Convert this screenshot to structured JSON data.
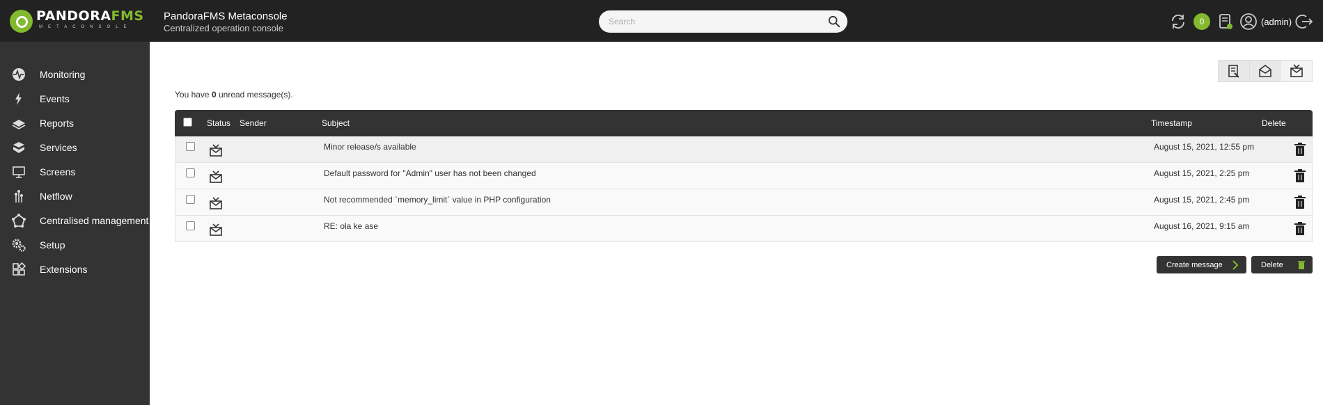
{
  "header": {
    "logo_main_a": "PANDORA",
    "logo_main_b": "FMS",
    "logo_sub": "METACONSOLE",
    "app_title": "PandoraFMS Metaconsole",
    "app_subtitle": "Centralized operation console",
    "search_placeholder": "Search",
    "notification_count": "0",
    "user_label": "(admin)"
  },
  "sidebar": {
    "items": [
      {
        "label": "Monitoring",
        "icon": "monitoring-icon"
      },
      {
        "label": "Events",
        "icon": "bolt-icon"
      },
      {
        "label": "Reports",
        "icon": "reports-icon"
      },
      {
        "label": "Services",
        "icon": "services-icon"
      },
      {
        "label": "Screens",
        "icon": "monitor-icon"
      },
      {
        "label": "Netflow",
        "icon": "netflow-icon"
      },
      {
        "label": "Centralised management",
        "icon": "network-icon"
      },
      {
        "label": "Setup",
        "icon": "gears-icon"
      },
      {
        "label": "Extensions",
        "icon": "extensions-icon"
      }
    ]
  },
  "main": {
    "unread_prefix": "You have ",
    "unread_count": "0",
    "unread_suffix": " unread message(s).",
    "columns": {
      "status": "Status",
      "sender": "Sender",
      "subject": "Subject",
      "timestamp": "Timestamp",
      "delete": "Delete"
    },
    "messages": [
      {
        "subject": "Minor release/s available",
        "timestamp": "August 15, 2021, 12:55 pm"
      },
      {
        "subject": "Default password for \"Admin\" user has not been changed",
        "timestamp": "August 15, 2021, 2:25 pm"
      },
      {
        "subject": "Not recommended `memory_limit` value in PHP configuration",
        "timestamp": "August 15, 2021, 2:45 pm"
      },
      {
        "subject": "RE: ola ke ase",
        "timestamp": "August 16, 2021, 9:15 am"
      }
    ],
    "create_button": "Create message",
    "delete_button": "Delete"
  },
  "colors": {
    "header_bg": "#222222",
    "sidebar_bg": "#333333",
    "accent": "#82b92e"
  }
}
